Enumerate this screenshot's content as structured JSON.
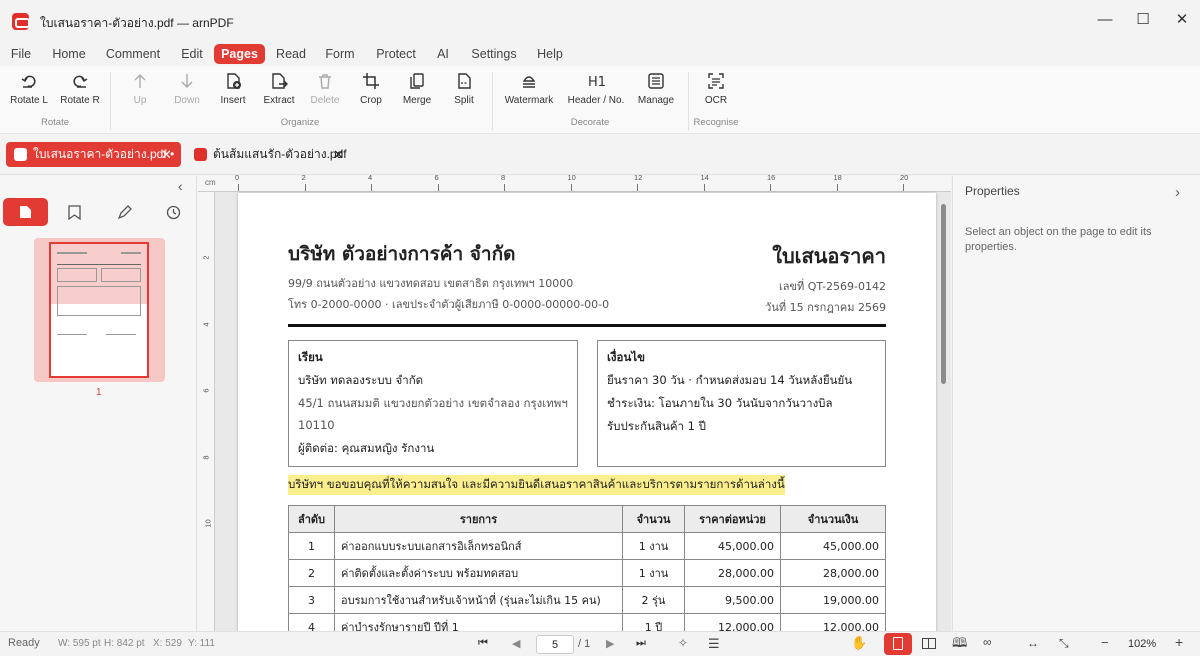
{
  "window": {
    "title": "ใบเสนอราคา-ตัวอย่าง.pdf — arnPDF"
  },
  "menu": [
    "File",
    "Home",
    "Comment",
    "Edit",
    "Pages",
    "Read",
    "Form",
    "Protect",
    "AI",
    "Settings",
    "Help"
  ],
  "ribbon": {
    "buttons": [
      "Rotate L",
      "Rotate R",
      "Up",
      "Down",
      "Insert",
      "Extract",
      "Delete",
      "Crop",
      "Merge",
      "Split",
      "Watermark",
      "Header / No.",
      "Manage",
      "OCR"
    ],
    "groups": [
      "Rotate",
      "Organize",
      "Decorate",
      "Recognise"
    ]
  },
  "tabs": [
    {
      "name": "ใบเสนอราคา-ตัวอย่าง.pdf •"
    },
    {
      "name": "ต้นส้มแสนรัก-ตัวอย่าง.pdf"
    }
  ],
  "sidebar": {
    "thumb_label": "1"
  },
  "ruler": {
    "unit": "cm",
    "h_ticks": [
      "0",
      "2",
      "4",
      "6",
      "8",
      "10",
      "12",
      "14",
      "16",
      "18",
      "20"
    ],
    "v_ticks": [
      "2",
      "4",
      "6",
      "8",
      "10"
    ]
  },
  "properties": {
    "title": "Properties",
    "hint": "Select an object on the page to edit its properties."
  },
  "doc": {
    "company": "บริษัท ตัวอย่างการค้า จำกัด",
    "address": "99/9 ถนนตัวอย่าง แขวงทดสอบ เขตสาธิต กรุงเทพฯ 10000",
    "contact": "โทร 0-2000-0000 · เลขประจำตัวผู้เสียภาษี 0-0000-00000-00-0",
    "doc_title": "ใบเสนอราคา",
    "doc_no": "เลขที่ QT-2569-0142",
    "doc_date": "วันที่ 15 กรกฎาคม 2569",
    "to_label": "เรียน",
    "to_name": "บริษัท ทดลองระบบ จำกัด",
    "to_addr1": "45/1 ถนนสมมติ แขวงยกตัวอย่าง เขตจำลอง กรุงเทพฯ",
    "to_addr2": "10110",
    "to_contact": "ผู้ติดต่อ: คุณสมหญิง รักงาน",
    "cond_label": "เงื่อนไข",
    "cond1": "ยืนราคา 30 วัน · กำหนดส่งมอบ 14 วันหลังยืนยัน",
    "cond2": "ชำระเงิน: โอนภายใน 30 วันนับจากวันวางบิล",
    "cond3": "รับประกันสินค้า 1 ปี",
    "highlight": "บริษัทฯ ขอขอบคุณที่ให้ความสนใจ และมีความยินดีเสนอราคาสินค้าและบริการตามรายการด้านล่างนี้",
    "table_headers": [
      "ลำดับ",
      "รายการ",
      "จำนวน",
      "ราคาต่อหน่วย",
      "จำนวนเงิน"
    ],
    "rows": [
      [
        "1",
        "ค่าออกแบบระบบเอกสารอิเล็กทรอนิกส์",
        "1 งาน",
        "45,000.00",
        "45,000.00"
      ],
      [
        "2",
        "ค่าติดตั้งและตั้งค่าระบบ พร้อมทดสอบ",
        "1 งาน",
        "28,000.00",
        "28,000.00"
      ],
      [
        "3",
        "อบรมการใช้งานสำหรับเจ้าหน้าที่ (รุ่นละไม่เกิน 15 คน)",
        "2 รุ่น",
        "9,500.00",
        "19,000.00"
      ],
      [
        "4",
        "ค่าบำรุงรักษารายปี ปีที่ 1",
        "1 ปี",
        "12,000.00",
        "12,000.00"
      ]
    ]
  },
  "status": {
    "ready": "Ready",
    "w": "W: 595 pt",
    "h": "H: 842 pt",
    "x": "X: 529",
    "y": "Y: 111",
    "page": "5",
    "pages": "/ 1",
    "zoom": "102%"
  }
}
